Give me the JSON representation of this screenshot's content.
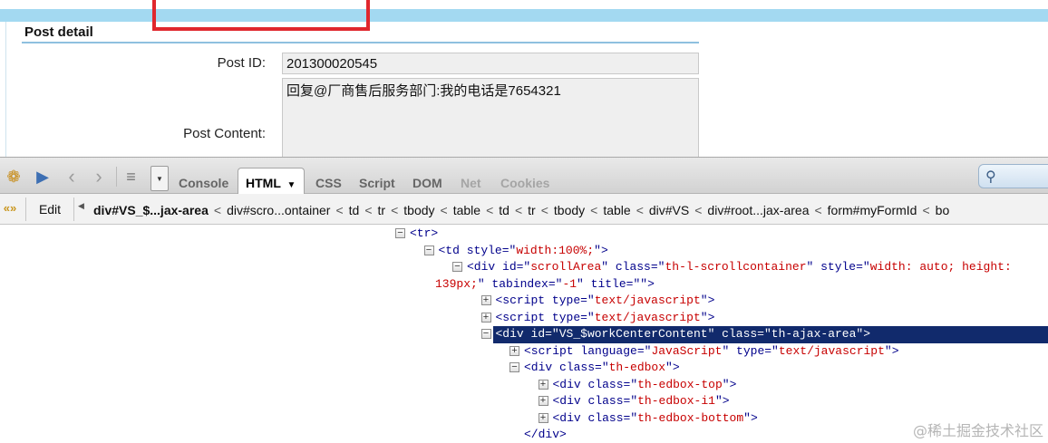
{
  "page": {
    "panel_title": "Post detail",
    "post_id_label": "Post ID:",
    "post_id_value": "201300020545",
    "post_content_label": "Post Content:",
    "post_content_value": "回复@厂商售后服务部门:我的电话是7654321"
  },
  "toolbar": {
    "icons": [
      "firebug-icon",
      "inspect-icon",
      "back-icon",
      "forward-icon",
      "command-list-icon"
    ],
    "tabs": [
      {
        "label": "Console",
        "state": "normal"
      },
      {
        "label": "HTML",
        "state": "active"
      },
      {
        "label": "CSS",
        "state": "normal"
      },
      {
        "label": "Script",
        "state": "normal"
      },
      {
        "label": "DOM",
        "state": "normal"
      },
      {
        "label": "Net",
        "state": "disabled"
      },
      {
        "label": "Cookies",
        "state": "disabled"
      }
    ],
    "html_tab_arrow": "▼"
  },
  "breadcrumb": {
    "edit_label": "Edit",
    "items": [
      "div#VS_$...jax-area",
      "div#scro...ontainer",
      "td",
      "tr",
      "tbody",
      "table",
      "td",
      "tr",
      "tbody",
      "table",
      "div#VS",
      "div#root...jax-area",
      "form#myFormId",
      "bo"
    ]
  },
  "tree": [
    {
      "indent": 0,
      "toggle": "−",
      "parts": [
        [
          "tag",
          "<tr>"
        ]
      ]
    },
    {
      "indent": 1,
      "toggle": "−",
      "parts": [
        [
          "tag",
          "<td "
        ],
        [
          "an",
          "style=\""
        ],
        [
          "av",
          "width:100%;"
        ],
        [
          "an",
          "\""
        ],
        [
          "tag",
          ">"
        ]
      ]
    },
    {
      "indent": 2,
      "toggle": "−",
      "parts": [
        [
          "tag",
          "<div "
        ],
        [
          "an",
          "id=\""
        ],
        [
          "av",
          "scrollArea"
        ],
        [
          "an",
          "\" class=\""
        ],
        [
          "av",
          "th-l-scrollcontainer"
        ],
        [
          "an",
          "\" style=\""
        ],
        [
          "av",
          "width: auto; height:"
        ]
      ]
    },
    {
      "indent": 2,
      "toggle": "",
      "cont": true,
      "parts": [
        [
          "av",
          "139px;"
        ],
        [
          "an",
          "\" tabindex=\""
        ],
        [
          "av",
          "-1"
        ],
        [
          "an",
          "\" title=\""
        ],
        [
          "an",
          "\""
        ],
        [
          "tag",
          ">"
        ]
      ]
    },
    {
      "indent": 3,
      "toggle": "+",
      "parts": [
        [
          "tag",
          "<script "
        ],
        [
          "an",
          "type=\""
        ],
        [
          "av",
          "text/javascript"
        ],
        [
          "an",
          "\""
        ],
        [
          "tag",
          ">"
        ]
      ]
    },
    {
      "indent": 3,
      "toggle": "+",
      "parts": [
        [
          "tag",
          "<script "
        ],
        [
          "an",
          "type=\""
        ],
        [
          "av",
          "text/javascript"
        ],
        [
          "an",
          "\""
        ],
        [
          "tag",
          ">"
        ]
      ]
    },
    {
      "indent": 3,
      "toggle": "−",
      "selected": true,
      "parts": [
        [
          "tag",
          "<div "
        ],
        [
          "an",
          "id=\""
        ],
        [
          "av",
          "VS_$workCenterContent"
        ],
        [
          "an",
          "\" class=\""
        ],
        [
          "av",
          "th-ajax-area"
        ],
        [
          "an",
          "\""
        ],
        [
          "tag",
          ">"
        ]
      ]
    },
    {
      "indent": 4,
      "toggle": "+",
      "parts": [
        [
          "tag",
          "<script "
        ],
        [
          "an",
          "language=\""
        ],
        [
          "av",
          "JavaScript"
        ],
        [
          "an",
          "\" type=\""
        ],
        [
          "av",
          "text/javascript"
        ],
        [
          "an",
          "\""
        ],
        [
          "tag",
          ">"
        ]
      ]
    },
    {
      "indent": 4,
      "toggle": "−",
      "parts": [
        [
          "tag",
          "<div "
        ],
        [
          "an",
          "class=\""
        ],
        [
          "av",
          "th-edbox"
        ],
        [
          "an",
          "\""
        ],
        [
          "tag",
          ">"
        ]
      ]
    },
    {
      "indent": 5,
      "toggle": "+",
      "parts": [
        [
          "tag",
          "<div "
        ],
        [
          "an",
          "class=\""
        ],
        [
          "av",
          "th-edbox-top"
        ],
        [
          "an",
          "\""
        ],
        [
          "tag",
          ">"
        ]
      ]
    },
    {
      "indent": 5,
      "toggle": "+",
      "parts": [
        [
          "tag",
          "<div "
        ],
        [
          "an",
          "class=\""
        ],
        [
          "av",
          "th-edbox-i1"
        ],
        [
          "an",
          "\""
        ],
        [
          "tag",
          ">"
        ]
      ]
    },
    {
      "indent": 5,
      "toggle": "+",
      "parts": [
        [
          "tag",
          "<div "
        ],
        [
          "an",
          "class=\""
        ],
        [
          "av",
          "th-edbox-bottom"
        ],
        [
          "an",
          "\""
        ],
        [
          "tag",
          ">"
        ]
      ]
    },
    {
      "indent": 4,
      "toggle": "",
      "parts": [
        [
          "tag",
          "</div>"
        ]
      ]
    }
  ],
  "watermark": "@稀土掘金技术社区"
}
